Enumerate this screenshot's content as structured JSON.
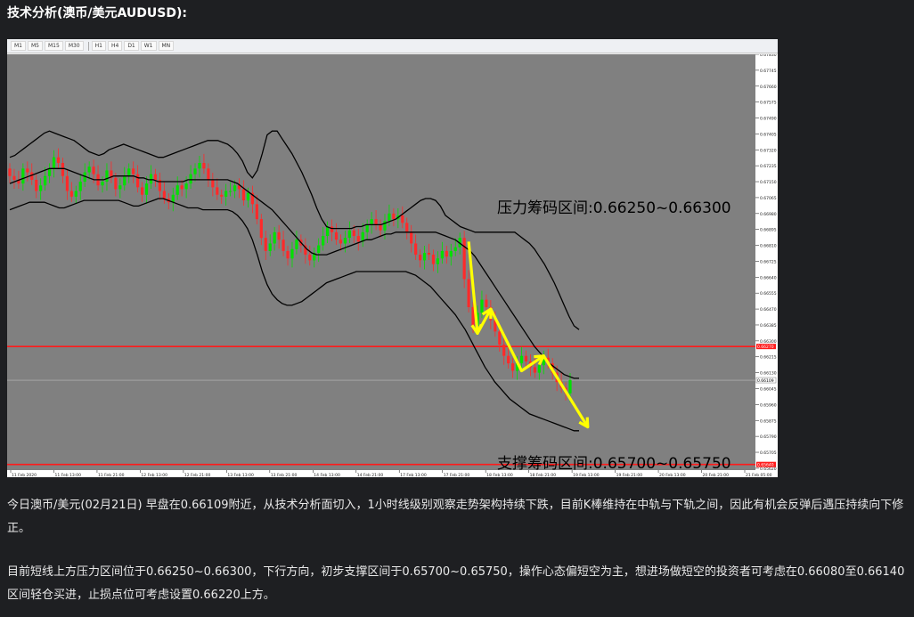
{
  "heading": "技术分析(澳币/美元AUDUSD):",
  "toolbar": {
    "timeframes": [
      "M1",
      "M5",
      "M15",
      "M30",
      "H1",
      "H4",
      "D1",
      "W1",
      "MN"
    ]
  },
  "colors": {
    "background": "#1e1f22",
    "plot_bg": "#808080",
    "bull": "#00e000",
    "bear": "#ff2a2a",
    "band": "#000000",
    "level_line": "#ff1a1a",
    "arrow": "#ffff00"
  },
  "chart_data": {
    "type": "candlestick",
    "symbol": "AUDUSD",
    "timeframe": "H1",
    "ylim": [
      0.6561,
      0.6783
    ],
    "y_ticks": [
      "0.67830",
      "0.67745",
      "0.67660",
      "0.67575",
      "0.67490",
      "0.67405",
      "0.67320",
      "0.67235",
      "0.67150",
      "0.67065",
      "0.66980",
      "0.66895",
      "0.66810",
      "0.66725",
      "0.66640",
      "0.66555",
      "0.66470",
      "0.66385",
      "0.66300",
      "0.66215",
      "0.66130",
      "0.66045",
      "0.65960",
      "0.65875",
      "0.65790",
      "0.65705",
      "0.65620"
    ],
    "x_ticks": [
      "11 Feb 2020",
      "11 Feb 13:00",
      "11 Feb 21:00",
      "12 Feb 13:00",
      "12 Feb 21:00",
      "13 Feb 13:00",
      "13 Feb 21:00",
      "14 Feb 13:00",
      "14 Feb 21:00",
      "17 Feb 13:00",
      "17 Feb 21:00",
      "18 Feb 13:00",
      "18 Feb 21:00",
      "19 Feb 13:00",
      "19 Feb 21:00",
      "20 Feb 13:00",
      "20 Feb 21:00",
      "21 Feb 05:00"
    ],
    "close": [
      0.6718,
      0.6716,
      0.6714,
      0.6722,
      0.672,
      0.6716,
      0.671,
      0.6713,
      0.6718,
      0.6722,
      0.6728,
      0.6725,
      0.6718,
      0.671,
      0.6707,
      0.671,
      0.6715,
      0.672,
      0.6723,
      0.6719,
      0.6713,
      0.6715,
      0.6721,
      0.6717,
      0.6711,
      0.6713,
      0.6718,
      0.6722,
      0.6719,
      0.6712,
      0.6708,
      0.6714,
      0.6719,
      0.6716,
      0.671,
      0.6706,
      0.6704,
      0.6708,
      0.6713,
      0.6711,
      0.6714,
      0.6719,
      0.6722,
      0.6725,
      0.6722,
      0.6716,
      0.6712,
      0.6708,
      0.6707,
      0.671,
      0.671,
      0.6713,
      0.6711,
      0.6705,
      0.6709,
      0.6703,
      0.6695,
      0.6685,
      0.6678,
      0.6682,
      0.6688,
      0.6684,
      0.6678,
      0.6674,
      0.6679,
      0.6684,
      0.6681,
      0.6676,
      0.6673,
      0.6677,
      0.6681,
      0.6686,
      0.6691,
      0.6688,
      0.6684,
      0.6682,
      0.6685,
      0.6689,
      0.6686,
      0.6683,
      0.6688,
      0.6692,
      0.6695,
      0.6692,
      0.6689,
      0.6694,
      0.6698,
      0.6695,
      0.6697,
      0.6693,
      0.6688,
      0.6682,
      0.6676,
      0.6673,
      0.6677,
      0.6676,
      0.6671,
      0.6674,
      0.6678,
      0.6675,
      0.6678,
      0.668,
      0.6685,
      0.6663,
      0.6648,
      0.6638,
      0.6645,
      0.6652,
      0.6648,
      0.6641,
      0.6635,
      0.6628,
      0.6622,
      0.6618,
      0.6614,
      0.6618,
      0.6622,
      0.6619,
      0.6616,
      0.6613,
      0.6617,
      0.6621,
      0.6618,
      0.6613,
      0.6608,
      0.6605,
      0.6602,
      0.6609
    ],
    "series": [
      {
        "name": "",
        "values": [
          0.6728,
          0.6729,
          0.6731,
          0.6733,
          0.6735,
          0.6737,
          0.6739,
          0.6741,
          0.6742,
          0.6741,
          0.674,
          0.6739,
          0.6738,
          0.6737,
          0.6735,
          0.6733,
          0.6731,
          0.673,
          0.6729,
          0.673,
          0.6732,
          0.6733,
          0.6734,
          0.6735,
          0.6734,
          0.6733,
          0.6732,
          0.6731,
          0.673,
          0.6729,
          0.6728,
          0.6728,
          0.6729,
          0.673,
          0.6731,
          0.6732,
          0.6733,
          0.6734,
          0.6735,
          0.6736,
          0.6737,
          0.6737,
          0.6737,
          0.6736,
          0.6735,
          0.6733,
          0.673,
          0.6726,
          0.672,
          0.6717,
          0.6721,
          0.673,
          0.674,
          0.6742,
          0.6742,
          0.6738,
          0.6734,
          0.673,
          0.6725,
          0.672,
          0.6714,
          0.6708,
          0.6701,
          0.6695,
          0.6691,
          0.669,
          0.669,
          0.669,
          0.669,
          0.669,
          0.6691,
          0.6691,
          0.6692,
          0.6692,
          0.6692,
          0.6692,
          0.6693,
          0.6694,
          0.6695,
          0.6697,
          0.6699,
          0.6701,
          0.6703,
          0.6705,
          0.6706,
          0.6706,
          0.6705,
          0.6702,
          0.6697,
          0.6695,
          0.6693,
          0.6691,
          0.669,
          0.6689,
          0.6688,
          0.6688,
          0.6688,
          0.6688,
          0.6688,
          0.6688,
          0.6688,
          0.6688,
          0.6688,
          0.6686,
          0.6684,
          0.6682,
          0.6679,
          0.6675,
          0.6671,
          0.6666,
          0.6661,
          0.6655,
          0.6649,
          0.6643,
          0.6638,
          0.6636
        ]
      },
      {
        "name": "",
        "values": [
          0.6714,
          0.6715,
          0.6716,
          0.6717,
          0.6718,
          0.6719,
          0.672,
          0.6721,
          0.6722,
          0.6722,
          0.6722,
          0.6722,
          0.6721,
          0.672,
          0.6719,
          0.6718,
          0.6717,
          0.6716,
          0.6716,
          0.6716,
          0.6717,
          0.6718,
          0.6718,
          0.6718,
          0.6718,
          0.6718,
          0.6717,
          0.6717,
          0.6716,
          0.6716,
          0.6715,
          0.6715,
          0.6715,
          0.6715,
          0.6715,
          0.6715,
          0.6716,
          0.6716,
          0.6716,
          0.6716,
          0.6716,
          0.6716,
          0.6716,
          0.6716,
          0.6716,
          0.6715,
          0.6714,
          0.6712,
          0.671,
          0.6708,
          0.6706,
          0.6704,
          0.6702,
          0.67,
          0.6697,
          0.6694,
          0.6691,
          0.6688,
          0.6685,
          0.6682,
          0.6679,
          0.6677,
          0.6676,
          0.6676,
          0.6676,
          0.6677,
          0.6678,
          0.6679,
          0.668,
          0.6681,
          0.6682,
          0.6683,
          0.6684,
          0.6684,
          0.6685,
          0.6686,
          0.6687,
          0.6687,
          0.6688,
          0.6688,
          0.6688,
          0.6688,
          0.6688,
          0.6688,
          0.6688,
          0.6688,
          0.6688,
          0.6687,
          0.6686,
          0.6685,
          0.6684,
          0.6682,
          0.668,
          0.6678,
          0.6675,
          0.6671,
          0.6667,
          0.6663,
          0.6659,
          0.6655,
          0.6651,
          0.6647,
          0.6643,
          0.6639,
          0.6635,
          0.6631,
          0.6627,
          0.6624,
          0.6621,
          0.6618,
          0.6616,
          0.6614,
          0.6612,
          0.6611,
          0.661,
          0.661
        ]
      },
      {
        "name": "",
        "values": [
          0.67,
          0.6701,
          0.6702,
          0.6703,
          0.6704,
          0.6704,
          0.6704,
          0.6704,
          0.6703,
          0.6702,
          0.6701,
          0.6701,
          0.6702,
          0.6703,
          0.6704,
          0.6705,
          0.6705,
          0.6705,
          0.6705,
          0.6705,
          0.6705,
          0.6705,
          0.6705,
          0.6704,
          0.6703,
          0.6702,
          0.6702,
          0.6703,
          0.6704,
          0.6705,
          0.6706,
          0.6706,
          0.6705,
          0.6704,
          0.6703,
          0.6702,
          0.6701,
          0.6701,
          0.6701,
          0.67,
          0.67,
          0.67,
          0.67,
          0.67,
          0.67,
          0.6699,
          0.6697,
          0.6694,
          0.669,
          0.6684,
          0.6676,
          0.6667,
          0.666,
          0.6655,
          0.6652,
          0.665,
          0.6649,
          0.6649,
          0.665,
          0.6651,
          0.6653,
          0.6655,
          0.6657,
          0.6659,
          0.6661,
          0.6662,
          0.6663,
          0.6664,
          0.6665,
          0.6666,
          0.6667,
          0.6667,
          0.6667,
          0.6667,
          0.6667,
          0.6667,
          0.6667,
          0.6667,
          0.6667,
          0.6667,
          0.6667,
          0.6666,
          0.6665,
          0.6663,
          0.6661,
          0.6659,
          0.6656,
          0.6653,
          0.665,
          0.6647,
          0.6644,
          0.664,
          0.6636,
          0.6631,
          0.6626,
          0.6621,
          0.6616,
          0.6612,
          0.6608,
          0.6605,
          0.6602,
          0.6599,
          0.6597,
          0.6595,
          0.6593,
          0.6591,
          0.659,
          0.6589,
          0.6588,
          0.6587,
          0.6586,
          0.6585,
          0.6584,
          0.6583,
          0.6582,
          0.6582
        ]
      }
    ],
    "levels": [
      0.6627,
      0.6564
    ],
    "level_tags": [
      "0.66270",
      "0.65640"
    ],
    "current_price": 0.6609,
    "current_tag": "0.66109",
    "annotations": [
      "压力筹码区间:0.66250~0.66300",
      "支撑筹码区间:0.65700~0.65750"
    ]
  },
  "paragraphs": [
    "今日澳币/美元(02月21日) 早盘在0.66109附近，从技术分析面切入，1小时线级别观察走势架构持续下跌，目前K棒维持在中轨与下轨之间，因此有机会反弹后遇压持续向下修正。",
    "目前短线上方压力区间位于0.66250~0.66300，下行方向，初步支撑区间于0.65700~0.65750，操作心态偏短空为主，想进场做短空的投资者可考虑在0.66080至0.66140区间轻仓买进，止损点位可考虑设置0.66220上方。"
  ]
}
